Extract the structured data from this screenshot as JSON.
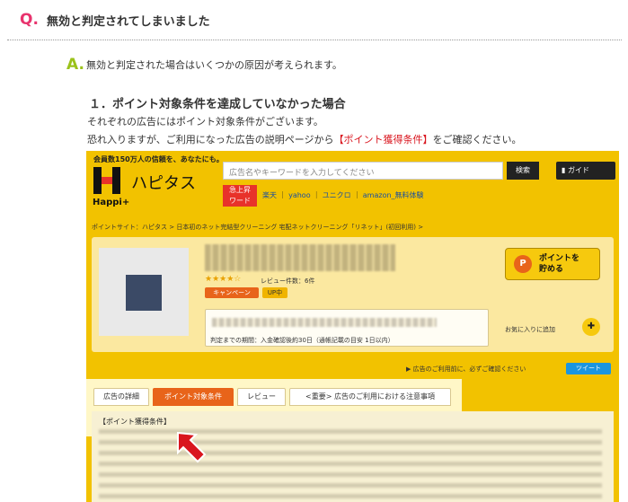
{
  "question": {
    "mark": "Q.",
    "text": "無効と判定されてしまいました"
  },
  "answer": {
    "mark": "A.",
    "text": "無効と判定された場合はいくつかの原因が考えられます。"
  },
  "section": {
    "title": "１．ポイント対象条件を達成していなかった場合",
    "line1": "それぞれの広告にはポイント対象条件がございます。",
    "line2_pre": "恐れ入りますが、ご利用になった広告の説明ページから",
    "line2_em": "【ポイント獲得条件】",
    "line2_post": "をご確認ください。"
  },
  "shot": {
    "tagline": "会員数150万人の信頼を、あなたにも。",
    "logo_sub": "Happi+",
    "logo_name": "ハピタス",
    "search_placeholder": "広告名やキーワードを入力してください",
    "search_button": "検索",
    "guide_button": "ガイド",
    "rank_badge_l1": "急上昇",
    "rank_badge_l2": "ワード",
    "quick_links": [
      "楽天",
      "yahoo",
      "ユニクロ",
      "amazon_無料体験"
    ],
    "breadcrumb": "ポイントサイト：ハピタス > 日本初のネット完結型クリーニング 宅配ネットクリーニング「リネット」(初回利用) >",
    "stars": "★★★★☆",
    "review": "レビュー件数：6件",
    "tag_campaign": "キャンペーン",
    "tag_up": "UP中",
    "period": "判定までの期間：入金確認後約30日（通帳記載の目安 1日以内）",
    "point_button_icon": "P",
    "point_button_l1": "ポイントを",
    "point_button_l2": "貯める",
    "favorite_label": "お気に入りに追加",
    "notice": "▶ 広告のご利用前に、必ずご確認ください",
    "tweet": "ツイート",
    "tabs": [
      "広告の詳細",
      "ポイント対象条件",
      "レビュー",
      "<重要> 広告のご利用における注意事項"
    ],
    "content_label": "【ポイント獲得条件】"
  },
  "colors": {
    "q_pink": "#e8336d",
    "a_green": "#9bc21b",
    "accent_red": "#d9151e",
    "brand_yellow": "#f2c200",
    "active_tab": "#e8641a"
  }
}
